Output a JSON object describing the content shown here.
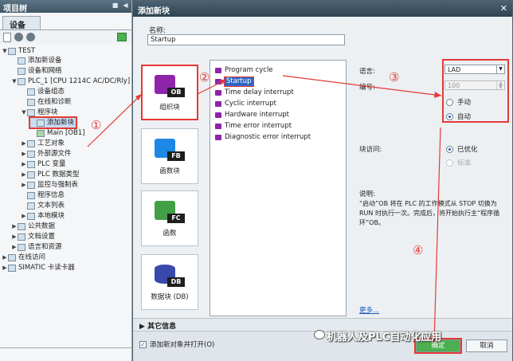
{
  "project_tree": {
    "title": "项目树",
    "tab": "设备",
    "items": [
      {
        "label": "TEST",
        "arrow": "▼"
      },
      {
        "label": "添加新设备",
        "arrow": ""
      },
      {
        "label": "设备和网络",
        "arrow": ""
      },
      {
        "label": "PLC_1 [CPU 1214C AC/DC/Rly]",
        "arrow": "▼"
      },
      {
        "label": "设备组态",
        "arrow": ""
      },
      {
        "label": "在线和诊断",
        "arrow": ""
      },
      {
        "label": "程序块",
        "arrow": "▼"
      },
      {
        "label": "添加新块",
        "arrow": ""
      },
      {
        "label": "Main [OB1]",
        "arrow": ""
      },
      {
        "label": "工艺对象",
        "arrow": "▶"
      },
      {
        "label": "外部源文件",
        "arrow": "▶"
      },
      {
        "label": "PLC 变量",
        "arrow": "▶"
      },
      {
        "label": "PLC 数据类型",
        "arrow": "▶"
      },
      {
        "label": "监控与强制表",
        "arrow": "▶"
      },
      {
        "label": "程序信息",
        "arrow": ""
      },
      {
        "label": "文本列表",
        "arrow": ""
      },
      {
        "label": "本地模块",
        "arrow": "▶"
      },
      {
        "label": "公共数据",
        "arrow": "▶"
      },
      {
        "label": "文档设置",
        "arrow": "▶"
      },
      {
        "label": "语言和资源",
        "arrow": "▶"
      },
      {
        "label": "在线访问",
        "arrow": "▶"
      },
      {
        "label": "SIMATIC 卡读卡器",
        "arrow": "▶"
      }
    ]
  },
  "dialog": {
    "title": "添加新块",
    "name_label": "名称:",
    "name_value": "Startup",
    "block_types": [
      {
        "tag": "OB",
        "label": "组织块",
        "color": "#8e24aa"
      },
      {
        "tag": "FB",
        "label": "函数块",
        "color": "#1e88e5"
      },
      {
        "tag": "FC",
        "label": "函数",
        "color": "#43a047"
      },
      {
        "tag": "DB",
        "label": "数据块 (DB)",
        "color": "#3949ab"
      }
    ],
    "ob_types": [
      "Program cycle",
      "Startup",
      "Time delay interrupt",
      "Cyclic interrupt",
      "Hardware interrupt",
      "Time error interrupt",
      "Diagnostic error interrupt"
    ],
    "language_label": "语言:",
    "language_value": "LAD",
    "number_label": "编号:",
    "number_value": "100",
    "manual_label": "手动",
    "auto_label": "自动",
    "access_label": "块访问:",
    "optimized_label": "已优化",
    "standard_label": "标准",
    "desc_label": "说明:",
    "description": "“启动”OB 将在 PLC 的工作模式从 STOP 切换为 RUN 时执行一次。完成后，将开始执行主“程序循环”OB。",
    "more_link": "更多...",
    "other_info": "其它信息",
    "add_open_label": "添加新对象并打开(O)",
    "ok_label": "确定",
    "cancel_label": "取消"
  },
  "markers": [
    "①",
    "②",
    "③",
    "④"
  ],
  "watermark": "机器人及PLC自动化应用",
  "colors": {
    "highlight": "#e53935",
    "selection": "#2d66c6",
    "ok": "#4caf50"
  }
}
